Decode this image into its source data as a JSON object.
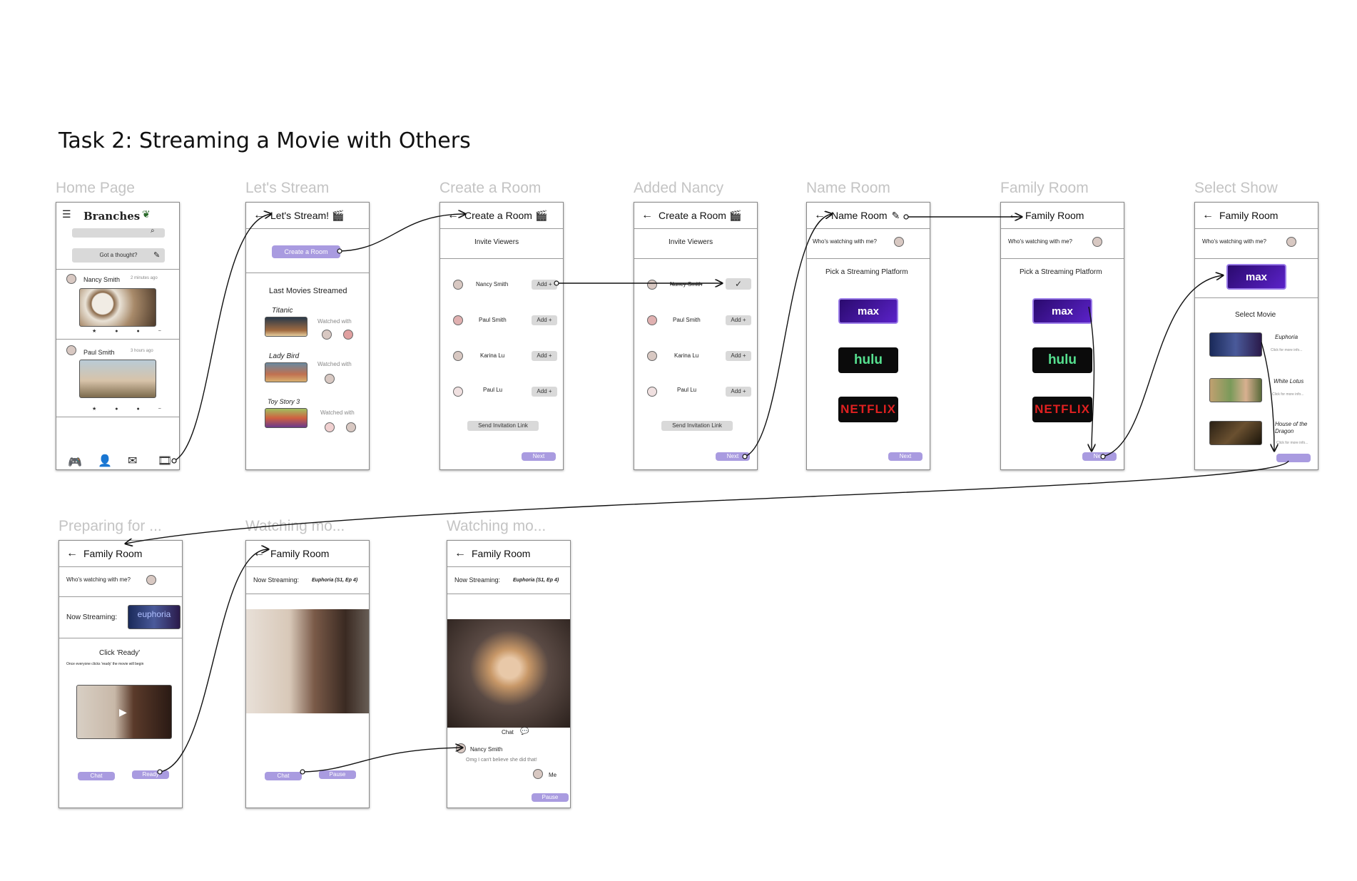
{
  "title": "Task 2: Streaming a Movie with Others",
  "frame_labels": [
    "Home Page",
    "Let's Stream",
    "Create a Room",
    "Added Nancy",
    "Name Room",
    "Family Room",
    "Select Show",
    "Preparing for ...",
    "Watching mo...",
    "Watching mo..."
  ],
  "home": {
    "logo": "Branches",
    "thought_placeholder": "Got a thought?",
    "posts": [
      {
        "user": "Nancy Smith",
        "time": "2 minutes ago"
      },
      {
        "user": "Paul Smith",
        "time": "3 hours ago"
      }
    ],
    "icons": [
      "menu-icon",
      "leaf-icon",
      "search-icon",
      "pencil-icon",
      "gamepad-icon",
      "profile-icon",
      "mail-icon",
      "film-icon"
    ]
  },
  "lets_stream": {
    "header": "Let's Stream!",
    "create_room": "Create a Room",
    "last_movies_heading": "Last Movies Streamed",
    "movies": [
      {
        "title": "Titanic",
        "watched_with": "Watched with"
      },
      {
        "title": "Lady Bird",
        "watched_with": "Watched with"
      },
      {
        "title": "Toy Story 3",
        "watched_with": "Watched with"
      }
    ]
  },
  "create_room": {
    "header": "Create a Room",
    "invite_heading": "Invite Viewers",
    "viewers": [
      "Nancy Smith",
      "Paul Smith",
      "Karina Lu",
      "Paul Lu"
    ],
    "add_label": "Add +",
    "send_link": "Send Invitation Link",
    "next": "Next"
  },
  "name_room": {
    "header": "Name Room",
    "whos_watching": "Who's watching with me?",
    "pick_platform": "Pick a Streaming Platform",
    "platforms": [
      "max",
      "hulu",
      "NETFLIX"
    ],
    "next": "Next"
  },
  "family_room": {
    "header": "Family Room",
    "whos_watching": "Who's watching with me?",
    "pick_platform": "Pick a Streaming Platform",
    "next": "Next"
  },
  "select_show": {
    "header": "Family Room",
    "whos_watching": "Who's watching with me?",
    "select_movie": "Select Movie",
    "shows": [
      {
        "title": "Euphoria",
        "more": "Click for more info..."
      },
      {
        "title": "White Lotus",
        "more": "Click for more info..."
      },
      {
        "title": "House of the Dragon",
        "more": "Click for more info..."
      }
    ]
  },
  "preparing": {
    "header": "Family Room",
    "whos_watching": "Who's watching with me?",
    "now_streaming": "Now Streaming:",
    "thumb_text": "euphoria",
    "click_ready": "Click 'Ready'",
    "ready_note": "Once everyone clicks 'ready' the movie will begin",
    "chat": "Chat",
    "ready": "Ready"
  },
  "watching1": {
    "header": "Family Room",
    "now_streaming": "Now Streaming:",
    "show": "Euphoria (S1, Ep 4)",
    "chat": "Chat",
    "pause": "Pause"
  },
  "watching2": {
    "header": "Family Room",
    "now_streaming": "Now Streaming:",
    "show": "Euphoria (S1, Ep 4)",
    "chat_label": "Chat",
    "chat_user": "Nancy Smith",
    "chat_message": "Omg I can't believe she did that!",
    "me": "Me",
    "pause": "Pause"
  },
  "colors": {
    "accent": "#a99be0",
    "max": "#3a0ea0",
    "hulu": "#56e08f",
    "netflix": "#e02020"
  }
}
